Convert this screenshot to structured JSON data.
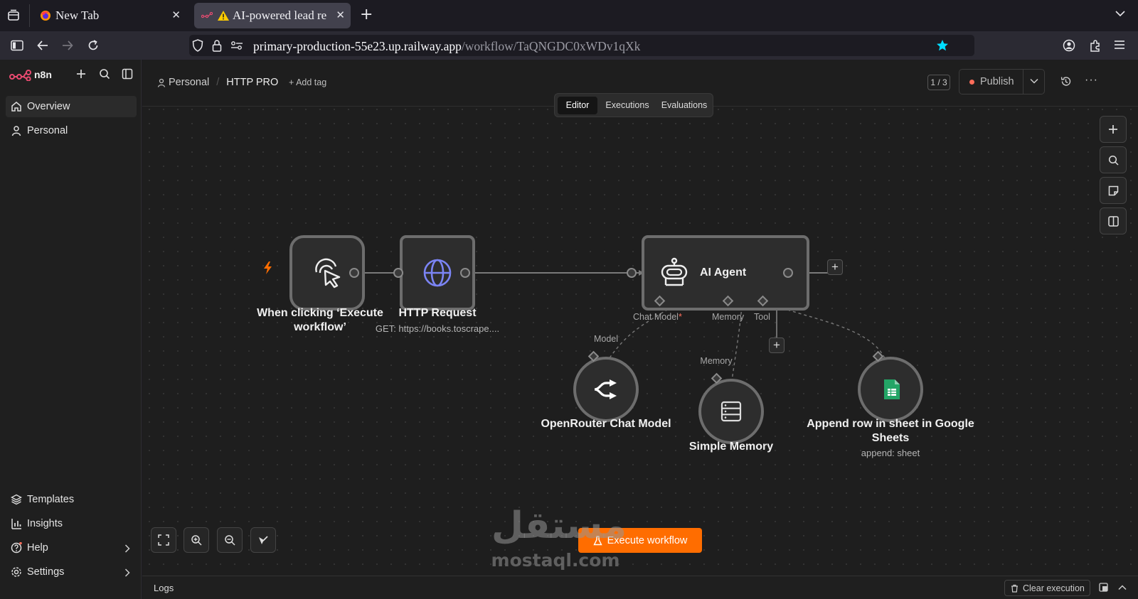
{
  "browser": {
    "tabs": [
      {
        "title": "New Tab",
        "active": false
      },
      {
        "title": "AI-powered lead re",
        "active": true
      }
    ],
    "url_host": "primary-production-55e23.up.railway.app",
    "url_path": "/workflow/TaQNGDC0xWDv1qXk"
  },
  "sidebar": {
    "logo_text": "n8n",
    "top_items": [
      {
        "label": "Overview",
        "icon": "home-icon",
        "active": true
      },
      {
        "label": "Personal",
        "icon": "user-icon",
        "active": false
      }
    ],
    "bottom_items": [
      {
        "label": "Templates",
        "icon": "templates-icon"
      },
      {
        "label": "Insights",
        "icon": "insights-icon"
      },
      {
        "label": "Help",
        "icon": "help-icon"
      },
      {
        "label": "Settings",
        "icon": "settings-icon"
      }
    ]
  },
  "header": {
    "breadcrumb_project": "Personal",
    "separator": "/",
    "workflow_name": "HTTP PRO",
    "add_tag": "+ Add tag",
    "version_counter": "1 / 3",
    "publish_label": "Publish",
    "tabs": [
      {
        "label": "Editor",
        "active": true
      },
      {
        "label": "Executions",
        "active": false
      },
      {
        "label": "Evaluations",
        "active": false
      }
    ]
  },
  "workflow": {
    "nodes": {
      "trigger": {
        "title": "When clicking ‘Execute workflow’",
        "icon": "cursor-click-icon"
      },
      "http": {
        "title": "HTTP Request",
        "subtitle": "GET: https://books.toscrape....",
        "icon": "globe-icon"
      },
      "agent": {
        "title": "AI Agent",
        "icon": "robot-icon"
      },
      "openrouter": {
        "title": "OpenRouter Chat Model",
        "icon": "openrouter-icon"
      },
      "memory": {
        "title": "Simple Memory",
        "icon": "database-icon"
      },
      "sheets": {
        "title": "Append row in sheet in Google Sheets",
        "subtitle": "append: sheet",
        "icon": "google-sheets-icon"
      }
    },
    "agent_ports": {
      "chat_model": "Chat Model",
      "required_mark": "*",
      "memory": "Memory",
      "tool": "Tool"
    },
    "sub_ports": {
      "model": "Model",
      "memory": "Memory"
    }
  },
  "canvas": {
    "execute_label": "Execute workflow",
    "watermark_arabic": "مستقل",
    "watermark_latin": "mostaql.com"
  },
  "logs": {
    "label": "Logs",
    "clear_label": "Clear execution"
  },
  "colors": {
    "accent": "#ff6d5a",
    "execute_button": "#ff6d00",
    "bookmark_star": "#00ddff",
    "trigger_bolt": "#ff6d00"
  }
}
